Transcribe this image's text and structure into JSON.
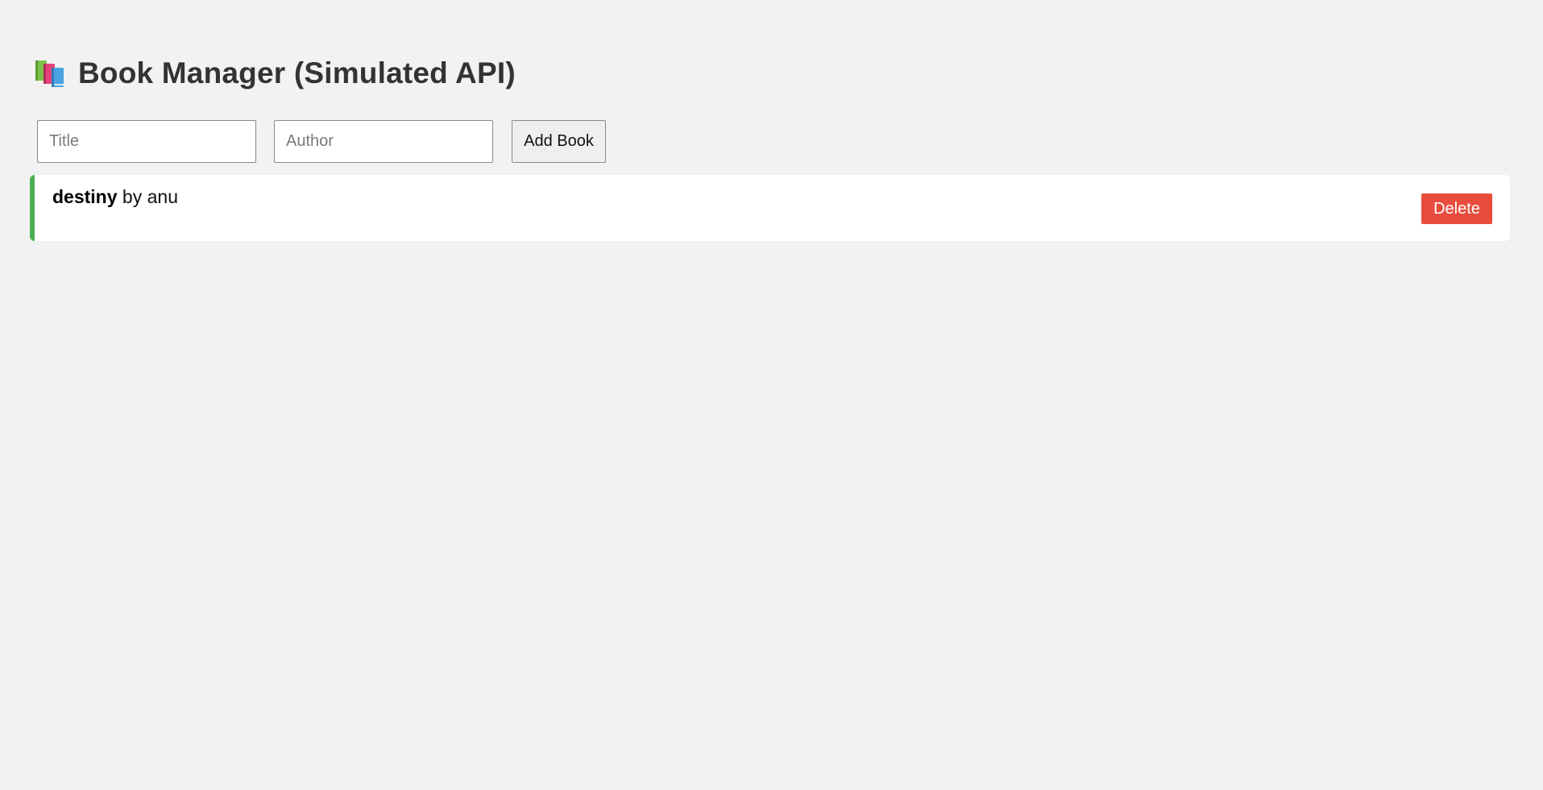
{
  "header": {
    "icon": "books-icon",
    "title": "Book Manager (Simulated API)"
  },
  "form": {
    "title_placeholder": "Title",
    "title_value": "",
    "author_placeholder": "Author",
    "author_value": "",
    "add_label": "Add Book"
  },
  "books": [
    {
      "title": "destiny",
      "by": "by",
      "author": "anu",
      "delete_label": "Delete"
    }
  ],
  "colors": {
    "background": "#f2f2f2",
    "accent_border": "#4caf50",
    "delete_button": "#e74c3c",
    "title_text": "#333333"
  }
}
